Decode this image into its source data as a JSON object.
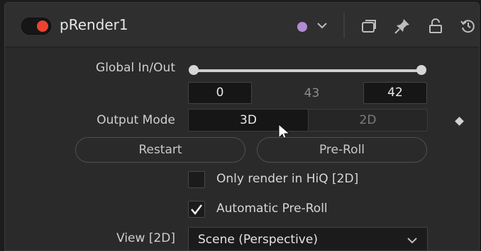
{
  "header": {
    "title": "pRender1",
    "color_swatch": "#b48bd3",
    "icons": [
      "power-toggle-icon",
      "color-dot-icon",
      "chevron-down-icon",
      "versions-icon",
      "pin-icon",
      "lock-icon",
      "reset-icon"
    ]
  },
  "global_in_out": {
    "label": "Global In/Out",
    "in": "0",
    "current": "43",
    "out": "42"
  },
  "output_mode": {
    "label": "Output Mode",
    "options": [
      "3D",
      "2D"
    ],
    "selected": "3D"
  },
  "buttons": {
    "restart": "Restart",
    "pre_roll": "Pre-Roll"
  },
  "checkboxes": [
    {
      "label": "Only render in HiQ [2D]",
      "checked": false
    },
    {
      "label": "Automatic Pre-Roll",
      "checked": true
    }
  ],
  "view": {
    "label": "View [2D]",
    "value": "Scene (Perspective)"
  },
  "colors": {
    "power_on": "#ea4430",
    "panel_bg": "#2a2a2b"
  }
}
